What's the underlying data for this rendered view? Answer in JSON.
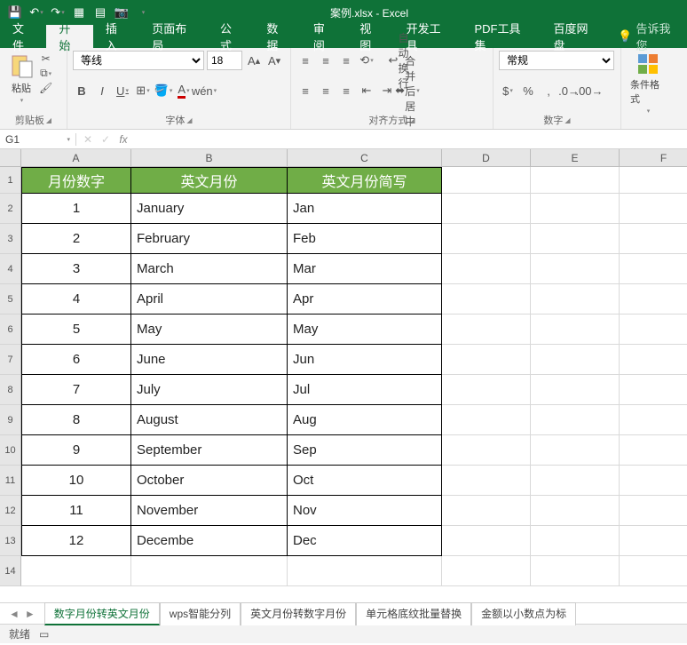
{
  "app": {
    "title": "案例.xlsx - Excel"
  },
  "qat": [
    "save-icon",
    "undo-icon",
    "redo-icon",
    "new-icon",
    "open-icon",
    "camera-icon"
  ],
  "tabs": {
    "items": [
      "文件",
      "开始",
      "插入",
      "页面布局",
      "公式",
      "数据",
      "审阅",
      "视图",
      "开发工具",
      "PDF工具集",
      "百度网盘"
    ],
    "active": "开始",
    "tell": "告诉我您"
  },
  "ribbon": {
    "clipboard": {
      "label": "剪贴板",
      "paste": "粘贴"
    },
    "font": {
      "label": "字体",
      "name": "等线",
      "size": "18",
      "wen": "wén"
    },
    "align": {
      "label": "对齐方式",
      "wrap": "自动换行",
      "merge": "合并后居中"
    },
    "number": {
      "label": "数字",
      "format": "常规"
    },
    "cond": {
      "label": "条件格式"
    }
  },
  "namebox": "G1",
  "formula": "",
  "columns": [
    "A",
    "B",
    "C",
    "D",
    "E",
    "F"
  ],
  "table": {
    "headers": [
      "月份数字",
      "英文月份",
      "英文月份简写"
    ],
    "rows": [
      {
        "n": "1",
        "en": "January",
        "ab": "Jan"
      },
      {
        "n": "2",
        "en": "February",
        "ab": "Feb"
      },
      {
        "n": "3",
        "en": "March",
        "ab": "Mar"
      },
      {
        "n": "4",
        "en": "April",
        "ab": "Apr"
      },
      {
        "n": "5",
        "en": "May",
        "ab": "May"
      },
      {
        "n": "6",
        "en": "June",
        "ab": "Jun"
      },
      {
        "n": "7",
        "en": "July",
        "ab": "Jul"
      },
      {
        "n": "8",
        "en": "August",
        "ab": "Aug"
      },
      {
        "n": "9",
        "en": "September",
        "ab": "Sep"
      },
      {
        "n": "10",
        "en": "October",
        "ab": "Oct"
      },
      {
        "n": "11",
        "en": "November",
        "ab": "Nov"
      },
      {
        "n": "12",
        "en": "Decembe",
        "ab": "Dec"
      }
    ]
  },
  "sheets": {
    "items": [
      "数字月份转英文月份",
      "wps智能分列",
      "英文月份转数字月份",
      "单元格底纹批量替换",
      "金额以小数点为标"
    ],
    "active": "数字月份转英文月份"
  },
  "status": {
    "ready": "就绪"
  }
}
